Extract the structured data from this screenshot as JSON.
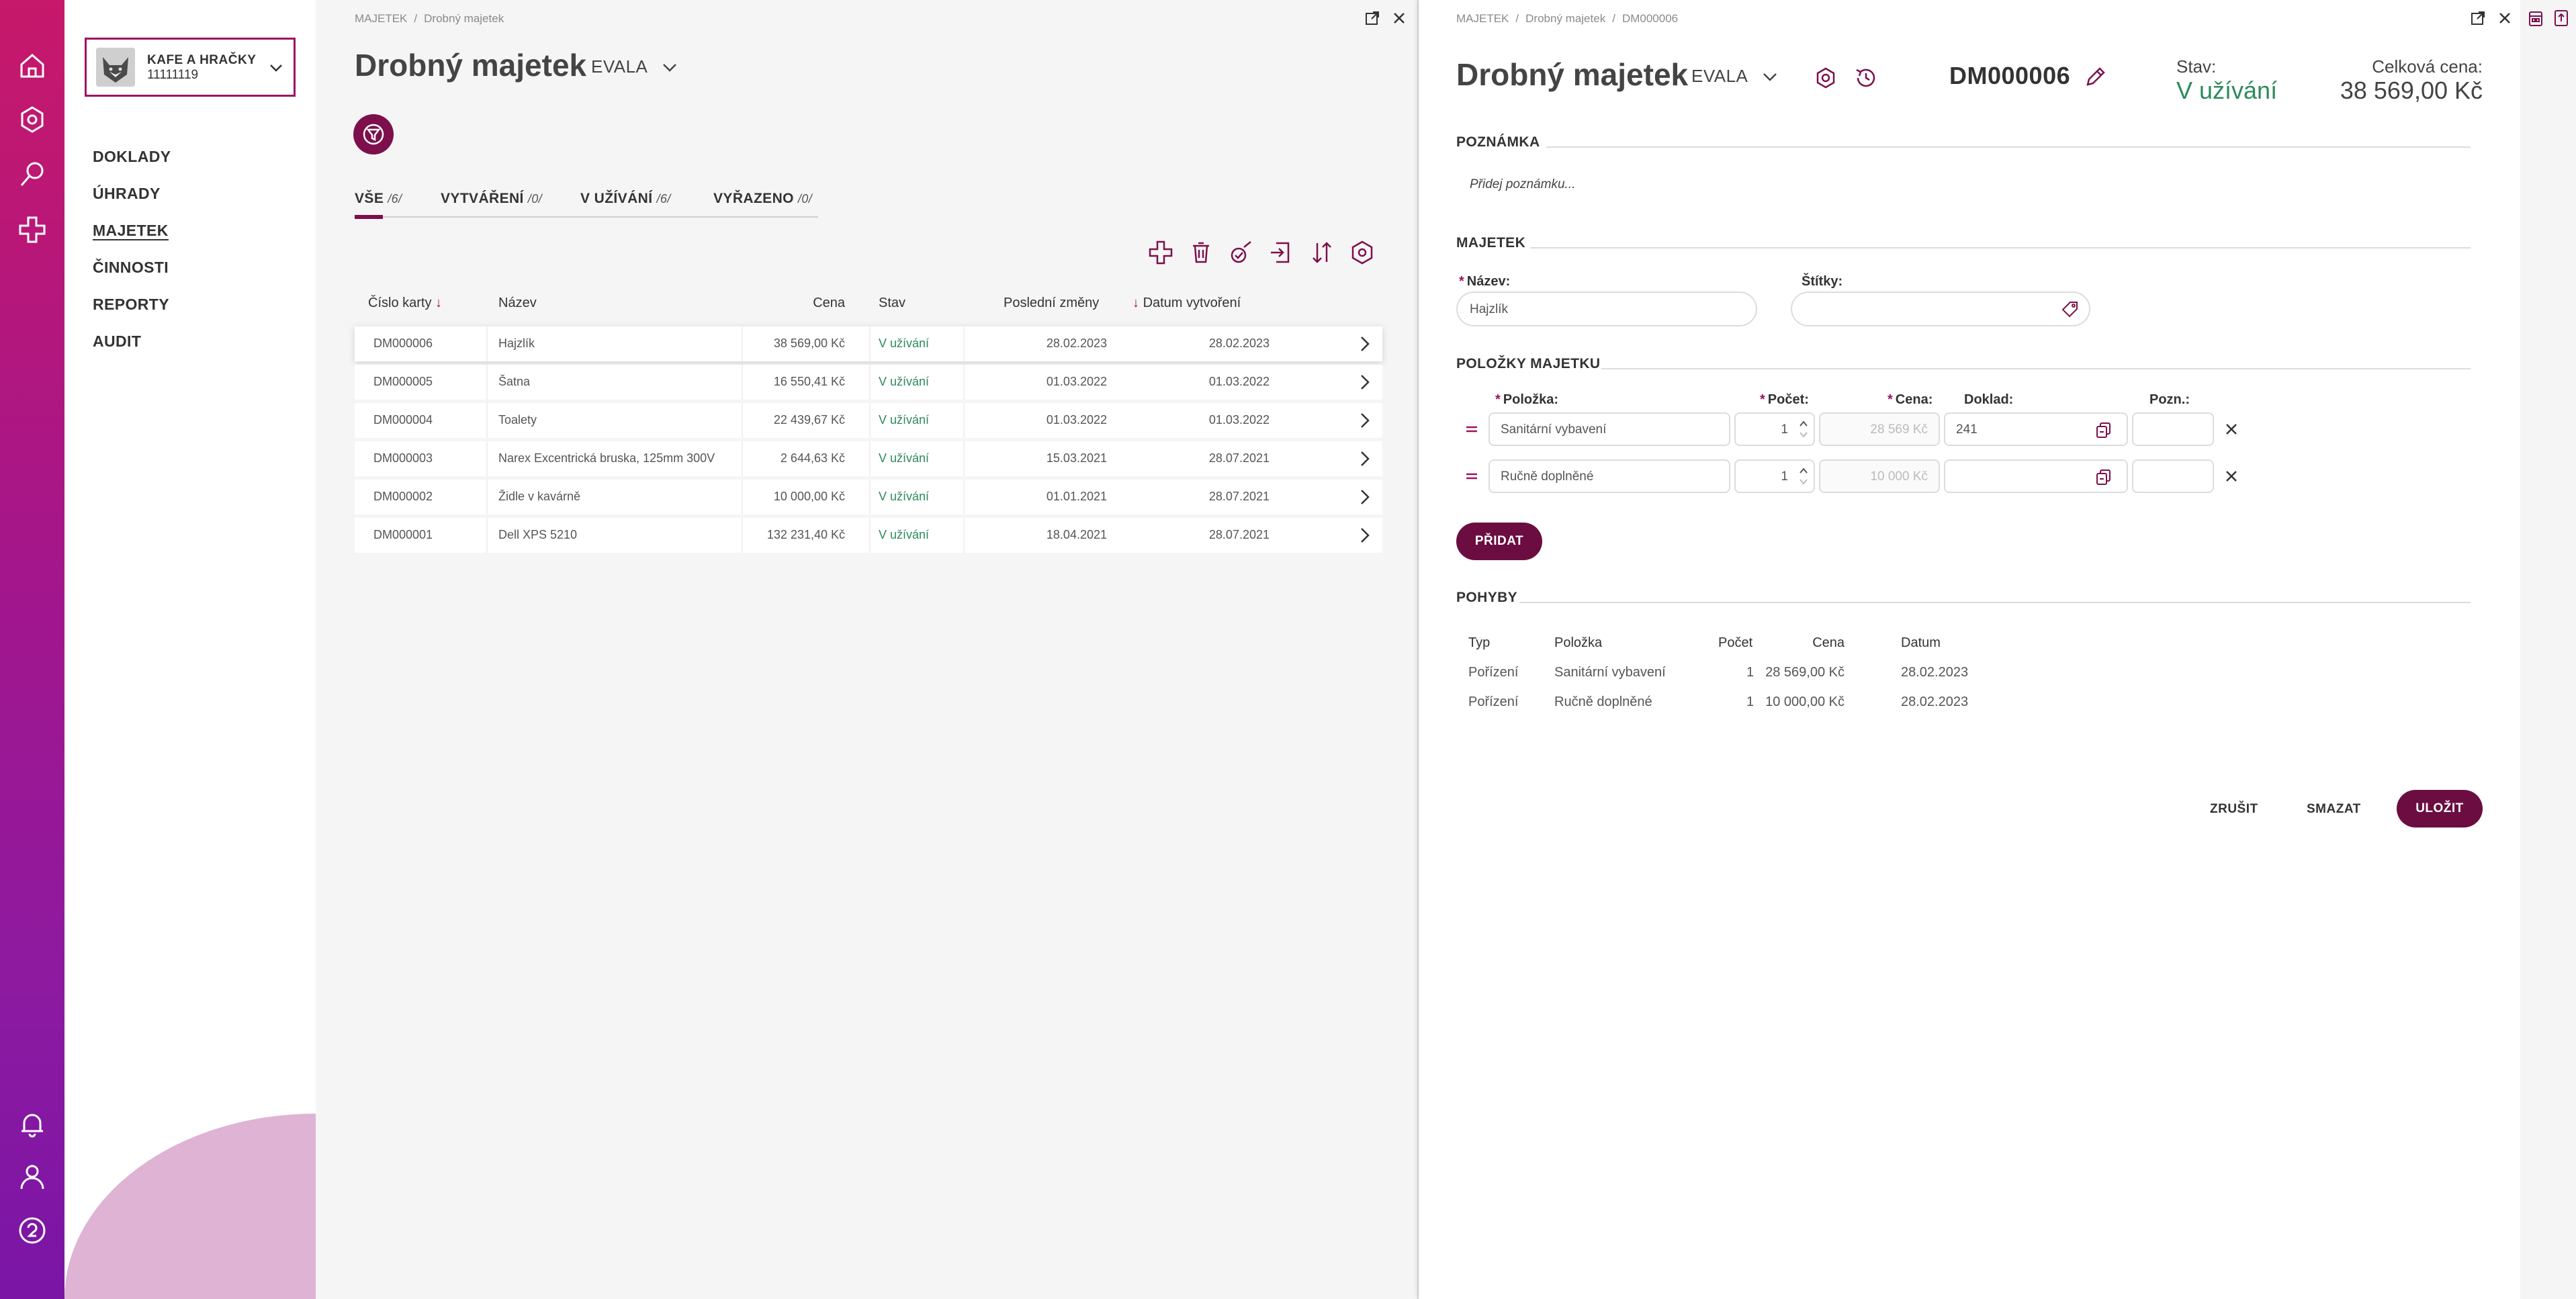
{
  "sidebar": {
    "company_name": "KAFE A HRAČKY",
    "company_id": "11111119",
    "nav": [
      "DOKLADY",
      "ÚHRADY",
      "MAJETEK",
      "ČINNOSTI",
      "REPORTY",
      "AUDIT"
    ]
  },
  "left": {
    "breadcrumb": [
      "MAJETEK",
      "Drobný majetek"
    ],
    "title": "Drobný majetek",
    "account": "EVALA",
    "tabs": [
      {
        "label": "VŠE",
        "count": "/6/"
      },
      {
        "label": "VYTVÁŘENÍ",
        "count": "/0/"
      },
      {
        "label": "V UŽÍVÁNÍ",
        "count": "/6/"
      },
      {
        "label": "VYŘAZENO",
        "count": "/0/"
      }
    ],
    "columns": {
      "card": "Číslo karty",
      "name": "Název",
      "price": "Cena",
      "status": "Stav",
      "changed": "Poslední změny",
      "created": "Datum vytvoření"
    },
    "rows": [
      {
        "card": "DM000006",
        "name": "Hajzlík",
        "price": "38 569,00 Kč",
        "status": "V užívání",
        "changed": "28.02.2023",
        "created": "28.02.2023"
      },
      {
        "card": "DM000005",
        "name": "Šatna",
        "price": "16 550,41 Kč",
        "status": "V užívání",
        "changed": "01.03.2022",
        "created": "01.03.2022"
      },
      {
        "card": "DM000004",
        "name": "Toalety",
        "price": "22 439,67 Kč",
        "status": "V užívání",
        "changed": "01.03.2022",
        "created": "01.03.2022"
      },
      {
        "card": "DM000003",
        "name": "Narex Excentrická bruska, 125mm 300V",
        "price": "2 644,63 Kč",
        "status": "V užívání",
        "changed": "15.03.2021",
        "created": "28.07.2021"
      },
      {
        "card": "DM000002",
        "name": "Židle v kavárně",
        "price": "10 000,00 Kč",
        "status": "V užívání",
        "changed": "01.01.2021",
        "created": "28.07.2021"
      },
      {
        "card": "DM000001",
        "name": "Dell XPS 5210",
        "price": "132 231,40 Kč",
        "status": "V užívání",
        "changed": "18.04.2021",
        "created": "28.07.2021"
      }
    ]
  },
  "right": {
    "breadcrumb": [
      "MAJETEK",
      "Drobný majetek",
      "DM000006"
    ],
    "title": "Drobný majetek",
    "account": "EVALA",
    "card_id": "DM000006",
    "status_label": "Stav:",
    "status_value": "V užívání",
    "total_label": "Celková cena:",
    "total_value": "38 569,00 Kč",
    "note_section": "POZNÁMKA",
    "note_placeholder": "Přidej poznámku...",
    "asset_section": "MAJETEK",
    "name_label": "Název:",
    "name_value": "Hajzlík",
    "tags_label": "Štítky:",
    "items_section": "POLOŽKY MAJETKU",
    "item_cols": {
      "item": "Položka:",
      "count": "Počet:",
      "price": "Cena:",
      "doc": "Doklad:",
      "note": "Pozn.:"
    },
    "items": [
      {
        "name": "Sanitární vybavení",
        "count": "1",
        "price": "28 569 Kč",
        "doc": "241",
        "note": ""
      },
      {
        "name": "Ručně doplněné",
        "count": "1",
        "price": "10 000 Kč",
        "doc": "",
        "note": ""
      }
    ],
    "add_label": "PŘIDAT",
    "moves_section": "POHYBY",
    "move_cols": {
      "type": "Typ",
      "item": "Položka",
      "count": "Počet",
      "price": "Cena",
      "date": "Datum"
    },
    "moves": [
      {
        "type": "Pořízení",
        "item": "Sanitární vybavení",
        "count": "1",
        "price": "28 569,00 Kč",
        "date": "28.02.2023"
      },
      {
        "type": "Pořízení",
        "item": "Ručně doplněné",
        "count": "1",
        "price": "10 000,00 Kč",
        "date": "28.02.2023"
      }
    ],
    "cancel_label": "ZRUŠIT",
    "delete_label": "SMAZAT",
    "save_label": "ULOŽIT"
  },
  "colors": {
    "accent": "#7d0f4c",
    "status_green": "#2d8a5a",
    "rail_top": "#c7186a",
    "rail_bottom": "#7a15a6"
  }
}
